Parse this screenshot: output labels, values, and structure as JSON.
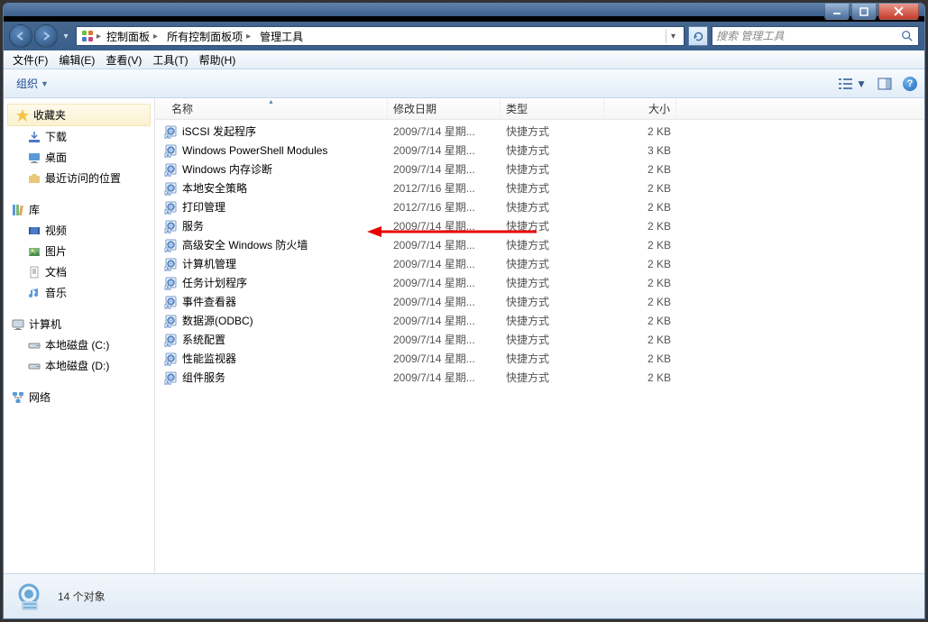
{
  "breadcrumb": {
    "items": [
      "控制面板",
      "所有控制面板项",
      "管理工具"
    ]
  },
  "search": {
    "placeholder": "搜索 管理工具"
  },
  "menu": {
    "items": [
      "文件(F)",
      "编辑(E)",
      "查看(V)",
      "工具(T)",
      "帮助(H)"
    ]
  },
  "toolbar": {
    "organize": "组织"
  },
  "sidebar": {
    "favorites": {
      "label": "收藏夹",
      "items": [
        "下载",
        "桌面",
        "最近访问的位置"
      ]
    },
    "libraries": {
      "label": "库",
      "items": [
        "视频",
        "图片",
        "文档",
        "音乐"
      ]
    },
    "computer": {
      "label": "计算机",
      "items": [
        "本地磁盘 (C:)",
        "本地磁盘 (D:)"
      ]
    },
    "network": {
      "label": "网络"
    }
  },
  "columns": {
    "name": "名称",
    "date": "修改日期",
    "type": "类型",
    "size": "大小"
  },
  "files": [
    {
      "name": "iSCSI 发起程序",
      "date": "2009/7/14 星期...",
      "type": "快捷方式",
      "size": "2 KB"
    },
    {
      "name": "Windows PowerShell Modules",
      "date": "2009/7/14 星期...",
      "type": "快捷方式",
      "size": "3 KB"
    },
    {
      "name": "Windows 内存诊断",
      "date": "2009/7/14 星期...",
      "type": "快捷方式",
      "size": "2 KB"
    },
    {
      "name": "本地安全策略",
      "date": "2012/7/16 星期...",
      "type": "快捷方式",
      "size": "2 KB"
    },
    {
      "name": "打印管理",
      "date": "2012/7/16 星期...",
      "type": "快捷方式",
      "size": "2 KB"
    },
    {
      "name": "服务",
      "date": "2009/7/14 星期...",
      "type": "快捷方式",
      "size": "2 KB"
    },
    {
      "name": "高级安全 Windows 防火墙",
      "date": "2009/7/14 星期...",
      "type": "快捷方式",
      "size": "2 KB"
    },
    {
      "name": "计算机管理",
      "date": "2009/7/14 星期...",
      "type": "快捷方式",
      "size": "2 KB"
    },
    {
      "name": "任务计划程序",
      "date": "2009/7/14 星期...",
      "type": "快捷方式",
      "size": "2 KB"
    },
    {
      "name": "事件查看器",
      "date": "2009/7/14 星期...",
      "type": "快捷方式",
      "size": "2 KB"
    },
    {
      "name": "数据源(ODBC)",
      "date": "2009/7/14 星期...",
      "type": "快捷方式",
      "size": "2 KB"
    },
    {
      "name": "系统配置",
      "date": "2009/7/14 星期...",
      "type": "快捷方式",
      "size": "2 KB"
    },
    {
      "name": "性能监视器",
      "date": "2009/7/14 星期...",
      "type": "快捷方式",
      "size": "2 KB"
    },
    {
      "name": "组件服务",
      "date": "2009/7/14 星期...",
      "type": "快捷方式",
      "size": "2 KB"
    }
  ],
  "status": {
    "count": "14 个对象"
  }
}
